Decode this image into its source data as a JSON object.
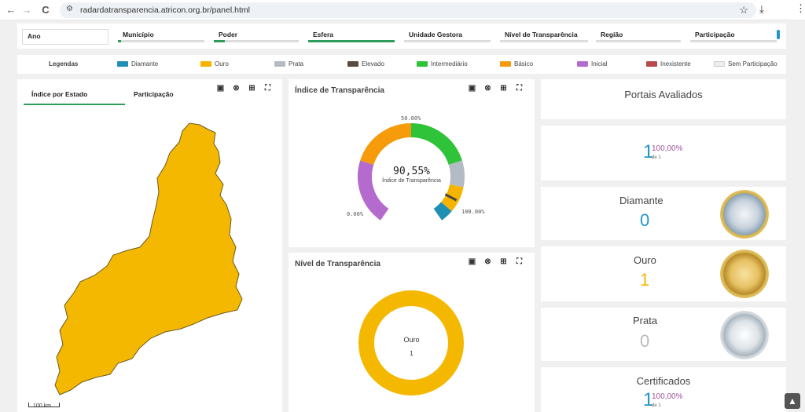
{
  "browser": {
    "url": "radardatransparencia.atricon.org.br/panel.html",
    "back": "←",
    "forward": "→",
    "reload": "C",
    "star": "☆",
    "download": "⤓",
    "menu": "⋮"
  },
  "filters": [
    "Ano",
    "Município",
    "Poder",
    "Esfera",
    "Unidade Gestora",
    "Nível de Transparência",
    "Região",
    "Participação"
  ],
  "legend": {
    "title": "Legendas",
    "items": [
      {
        "label": "Diamante",
        "color": "#1f8fb3"
      },
      {
        "label": "Ouro",
        "color": "#f5b400"
      },
      {
        "label": "Prata",
        "color": "#b3bcc4"
      },
      {
        "label": "Elevado",
        "color": "#5a4a42"
      },
      {
        "label": "Intermediário",
        "color": "#2ec338"
      },
      {
        "label": "Básico",
        "color": "#f59b0c"
      },
      {
        "label": "Inicial",
        "color": "#b56bcd"
      },
      {
        "label": "Inexistente",
        "color": "#b84a4e"
      },
      {
        "label": "Sem Participação",
        "color": "#eeeeee"
      }
    ]
  },
  "map": {
    "tab_active": "Índice por Estado",
    "tab_other": "Participação",
    "scale": "100 km",
    "fill": "#f5b800"
  },
  "gauge": {
    "title": "Índice de Transparência",
    "value": "90,55%",
    "caption": "Índice de Transparência",
    "label_min": "0.00%",
    "label_mid": "50.00%",
    "label_max": "100.00%",
    "value_fraction": 0.9055
  },
  "donut": {
    "title": "Nível de Transparência",
    "label": "Ouro",
    "count": "1",
    "color": "#f5b800"
  },
  "portais": {
    "title": "Portais Avaliados",
    "count": "1",
    "pct": "100,00%",
    "de": "de 1"
  },
  "diamante": {
    "label": "Diamante",
    "value": "0"
  },
  "ouro": {
    "label": "Ouro",
    "value": "1"
  },
  "prata": {
    "label": "Prata",
    "value": "0"
  },
  "certificados": {
    "title": "Certificados",
    "count": "1",
    "pct": "100,00%",
    "de": "de 1"
  }
}
